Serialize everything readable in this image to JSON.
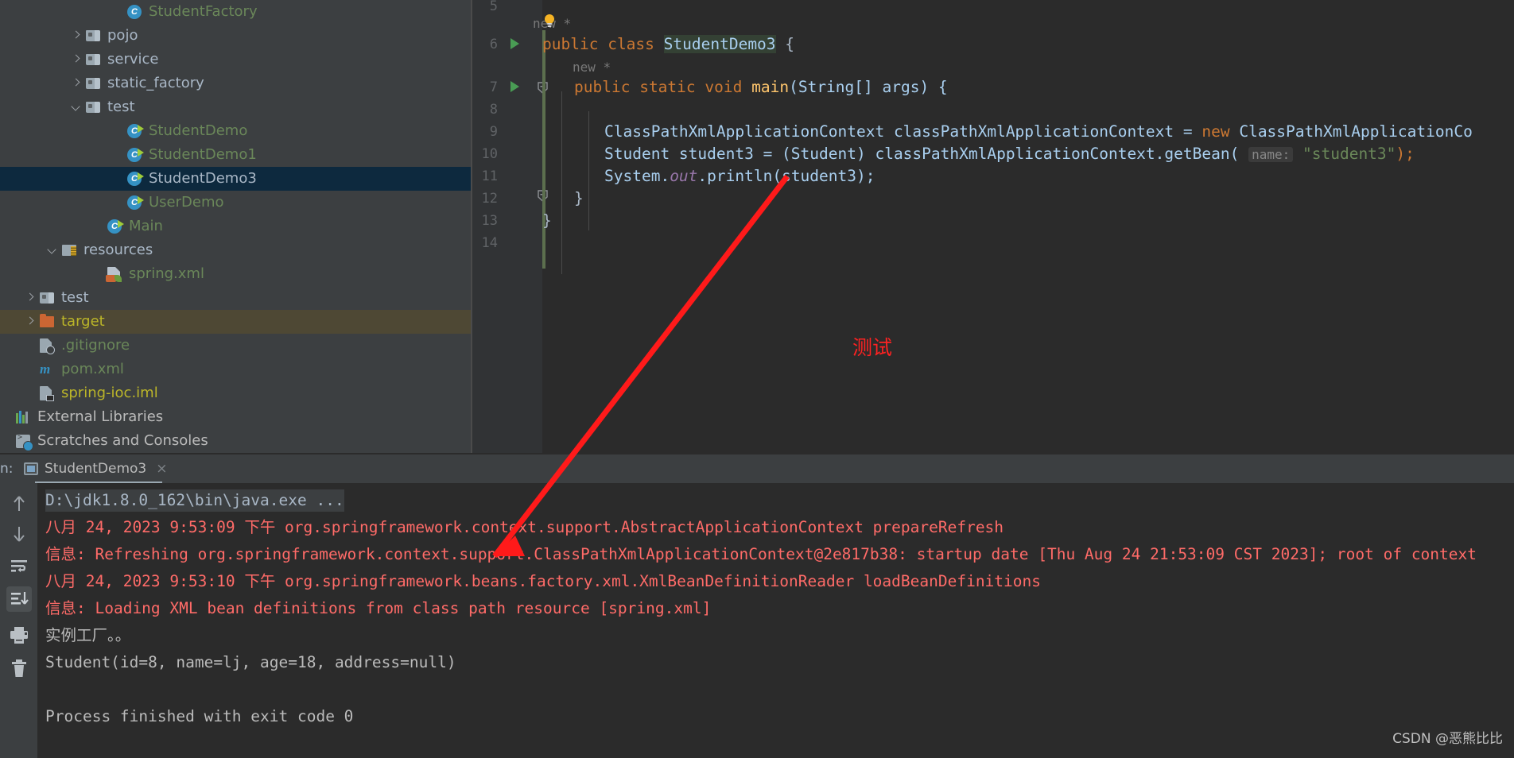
{
  "project_tree": {
    "items": [
      {
        "label": "StudentFactory",
        "icon": "java-class-icon",
        "indent": 140,
        "color": "green",
        "arrow": "",
        "state": ""
      },
      {
        "label": "pojo",
        "icon": "folder-icon",
        "indent": 88,
        "color": "grey",
        "arrow": "right",
        "state": ""
      },
      {
        "label": "service",
        "icon": "folder-icon",
        "indent": 88,
        "color": "grey",
        "arrow": "right",
        "state": ""
      },
      {
        "label": "static_factory",
        "icon": "folder-icon",
        "indent": 88,
        "color": "grey",
        "arrow": "right",
        "state": ""
      },
      {
        "label": "test",
        "icon": "folder-icon",
        "indent": 88,
        "color": "grey",
        "arrow": "down",
        "state": ""
      },
      {
        "label": "StudentDemo",
        "icon": "java-class-runnable-icon",
        "indent": 140,
        "color": "green",
        "arrow": "",
        "state": ""
      },
      {
        "label": "StudentDemo1",
        "icon": "java-class-runnable-icon",
        "indent": 140,
        "color": "green",
        "arrow": "",
        "state": ""
      },
      {
        "label": "StudentDemo3",
        "icon": "java-class-runnable-icon",
        "indent": 140,
        "color": "grey",
        "arrow": "",
        "state": "selected"
      },
      {
        "label": "UserDemo",
        "icon": "java-class-runnable-icon",
        "indent": 140,
        "color": "green",
        "arrow": "",
        "state": ""
      },
      {
        "label": "Main",
        "icon": "java-class-runnable-icon",
        "indent": 115,
        "color": "green",
        "arrow": "",
        "state": ""
      },
      {
        "label": "resources",
        "icon": "resources-folder-icon",
        "indent": 58,
        "color": "grey",
        "arrow": "down",
        "state": ""
      },
      {
        "label": "spring.xml",
        "icon": "spring-xml-icon",
        "indent": 115,
        "color": "green",
        "arrow": "",
        "state": ""
      },
      {
        "label": "test",
        "icon": "folder-icon",
        "indent": 30,
        "color": "grey",
        "arrow": "right",
        "state": ""
      },
      {
        "label": "target",
        "icon": "orange-folder-icon",
        "indent": 30,
        "color": "olive",
        "arrow": "right",
        "state": "target"
      },
      {
        "label": ".gitignore",
        "icon": "gitignore-icon",
        "indent": 30,
        "color": "green",
        "arrow": "",
        "state": ""
      },
      {
        "label": "pom.xml",
        "icon": "maven-icon",
        "indent": 30,
        "color": "green",
        "arrow": "",
        "state": ""
      },
      {
        "label": "spring-ioc.iml",
        "icon": "iml-icon",
        "indent": 30,
        "color": "olive",
        "arrow": "",
        "state": ""
      },
      {
        "label": "External Libraries",
        "icon": "libraries-icon",
        "indent": 0,
        "color": "white",
        "arrow": "",
        "state": ""
      },
      {
        "label": "Scratches and Consoles",
        "icon": "scratches-icon",
        "indent": 0,
        "color": "white",
        "arrow": "",
        "state": ""
      }
    ]
  },
  "editor": {
    "line_numbers": [
      "5",
      "6",
      "7",
      "8",
      "9",
      "10",
      "11",
      "12",
      "13",
      "14"
    ],
    "hint_new_1": "new *",
    "hint_new_2": "new *",
    "code": {
      "l6_public": "public",
      "l6_class": "class",
      "l6_name": "StudentDemo3",
      "l6_brace": "{",
      "l7_public": "public",
      "l7_static": "static",
      "l7_void": "void",
      "l7_main": "main",
      "l7_args": "(String[] args) {",
      "l9_type": "ClassPathXmlApplicationContext classPathXmlApplicationContext = ",
      "l9_new": "new",
      "l9_rest": " ClassPathXmlApplicationCo",
      "l10_a": "Student student3 = (Student) classPathXmlApplicationContext.getBean(",
      "l10_hint": "name:",
      "l10_str": "\"student3\"",
      "l10_end": ");",
      "l11_a": "System.",
      "l11_out": "out",
      "l11_b": ".println(student3);",
      "l12_brace": "}",
      "l13_brace": "}"
    }
  },
  "run_panel": {
    "label": "n:",
    "tab_name": "StudentDemo3",
    "close": "×",
    "toolbar": [
      "scroll-up-icon",
      "scroll-down-icon",
      "soft-wrap-icon",
      "scroll-to-end-icon",
      "print-icon",
      "trash-icon"
    ],
    "console_lines": [
      {
        "text": "D:\\jdk1.8.0_162\\bin\\java.exe ...",
        "type": "cmd"
      },
      {
        "text": "八月 24, 2023 9:53:09 下午 org.springframework.context.support.AbstractApplicationContext prepareRefresh",
        "type": "err"
      },
      {
        "text": "信息: Refreshing org.springframework.context.support.ClassPathXmlApplicationContext@2e817b38: startup date [Thu Aug 24 21:53:09 CST 2023]; root of context",
        "type": "err"
      },
      {
        "text": "八月 24, 2023 9:53:10 下午 org.springframework.beans.factory.xml.XmlBeanDefinitionReader loadBeanDefinitions",
        "type": "err"
      },
      {
        "text": "信息: Loading XML bean definitions from class path resource [spring.xml]",
        "type": "err"
      },
      {
        "text": "实例工厂。。",
        "type": "out"
      },
      {
        "text": "Student(id=8, name=lj, age=18, address=null)",
        "type": "out"
      },
      {
        "text": "",
        "type": "out"
      },
      {
        "text": "Process finished with exit code 0",
        "type": "out"
      }
    ]
  },
  "annotation": {
    "text": "测试",
    "color": "#ff2222"
  },
  "watermark": "CSDN @恶熊比比"
}
